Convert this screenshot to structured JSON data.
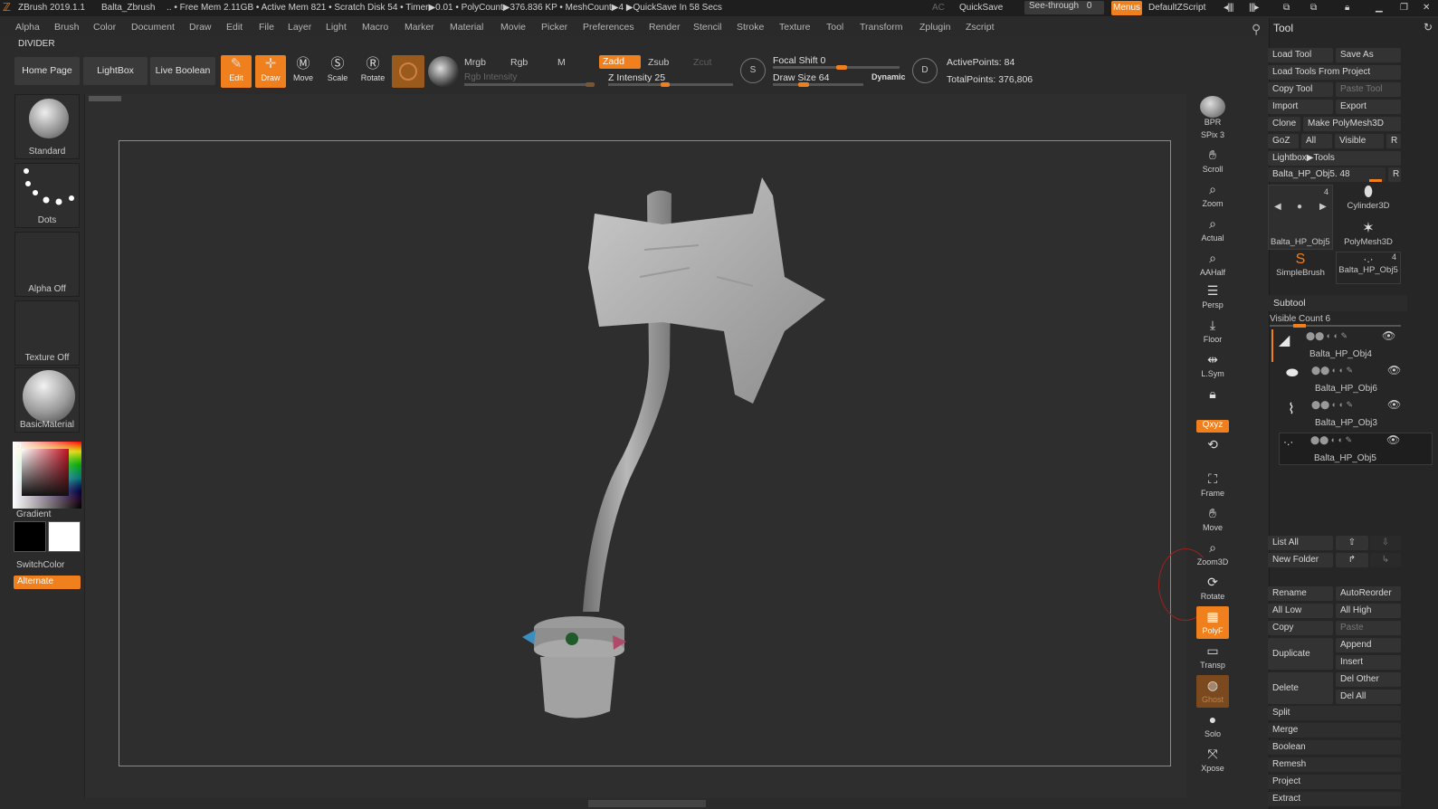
{
  "titlebar": {
    "app": "ZBrush 2019.1.1",
    "project": "Balta_Zbrush",
    "stats": ".. • Free Mem 2.11GB • Active Mem 821 • Scratch Disk 54 •  Timer▶0.01 • PolyCount▶376.836 KP  • MeshCount▶4  ▶QuickSave In 58 Secs",
    "ac": "AC",
    "quicksave": "QuickSave",
    "see_through": "See-through",
    "see_through_value": "0",
    "menus": "Menus",
    "script": "DefaultZScript"
  },
  "menubar": [
    "Alpha",
    "Brush",
    "Color",
    "Document",
    "Draw",
    "Edit",
    "File",
    "Layer",
    "Light",
    "Macro",
    "Marker",
    "Material",
    "Movie",
    "Picker",
    "Preferences",
    "Render",
    "Stencil",
    "Stroke",
    "Texture",
    "Tool",
    "Transform",
    "Zplugin",
    "Zscript"
  ],
  "divider": "DIVIDER",
  "toolbar": {
    "home": "Home Page",
    "lightbox": "LightBox",
    "live_boolean": "Live Boolean",
    "edit": "Edit",
    "draw": "Draw",
    "move": "Move",
    "scale": "Scale",
    "rotate": "Rotate",
    "mrgb": "Mrgb",
    "rgb": "Rgb",
    "m": "M",
    "zadd": "Zadd",
    "zsub": "Zsub",
    "zcut": "Zcut",
    "rgb_intensity": "Rgb Intensity",
    "z_intensity": "Z Intensity 25",
    "z_intensity_value": 25,
    "focal_shift": "Focal Shift 0",
    "draw_size": "Draw Size 64",
    "draw_size_value": 64,
    "dynamic": "Dynamic",
    "active_points": "ActivePoints: 84",
    "total_points": "TotalPoints: 376,806"
  },
  "leftshelf": {
    "brush": "Standard",
    "stroke": "Dots",
    "alpha": "Alpha Off",
    "texture": "Texture Off",
    "material": "BasicMaterial",
    "gradient": "Gradient",
    "switch_color": "SwitchColor",
    "alternate": "Alternate"
  },
  "rightshelf": [
    "BPR",
    "SPix 3",
    "Scroll",
    "Zoom",
    "Actual",
    "AAHalf",
    "Persp",
    "Floor",
    "L.Sym",
    "Frame",
    "Move",
    "Zoom3D",
    "Rotate",
    "PolyF",
    "Transp",
    "Ghost",
    "Solo",
    "Xpose"
  ],
  "rightshelf_xyz": "Qxyz",
  "toolpanel": {
    "title": "Tool",
    "load_tool": "Load Tool",
    "save_as": "Save As",
    "load_from_project": "Load Tools From Project",
    "copy_tool": "Copy Tool",
    "paste_tool": "Paste Tool",
    "import": "Import",
    "export": "Export",
    "clone": "Clone",
    "make_polymesh": "Make PolyMesh3D",
    "goz": "GoZ",
    "all": "All",
    "visible": "Visible",
    "r": "R",
    "lightbox_tools": "Lightbox▶Tools",
    "current_tool": "Balta_HP_Obj5. 48",
    "thumbs": [
      {
        "label": "Balta_HP_Obj5",
        "count": "4"
      },
      {
        "label": "Cylinder3D",
        "count": ""
      },
      {
        "label": "PolyMesh3D",
        "count": ""
      },
      {
        "label": "SimpleBrush",
        "count": ""
      },
      {
        "label": "Balta_HP_Obj5",
        "count": "4"
      }
    ],
    "subtool_header": "Subtool",
    "visible_count": "Visible Count 6",
    "subtools": [
      "Balta_HP_Obj4",
      "Balta_HP_Obj6",
      "Balta_HP_Obj3",
      "Balta_HP_Obj5"
    ],
    "list_all": "List All",
    "new_folder": "New Folder",
    "rename": "Rename",
    "autoreorder": "AutoReorder",
    "all_low": "All Low",
    "all_high": "All High",
    "copy": "Copy",
    "paste": "Paste",
    "duplicate": "Duplicate",
    "append": "Append",
    "insert": "Insert",
    "delete": "Delete",
    "del_other": "Del Other",
    "del_all": "Del All",
    "split": "Split",
    "merge": "Merge",
    "boolean": "Boolean",
    "remesh": "Remesh",
    "project": "Project",
    "extract": "Extract"
  },
  "colors": {
    "accent": "#f07f1e",
    "bg": "#2b2b2b",
    "panel": "#262626"
  }
}
